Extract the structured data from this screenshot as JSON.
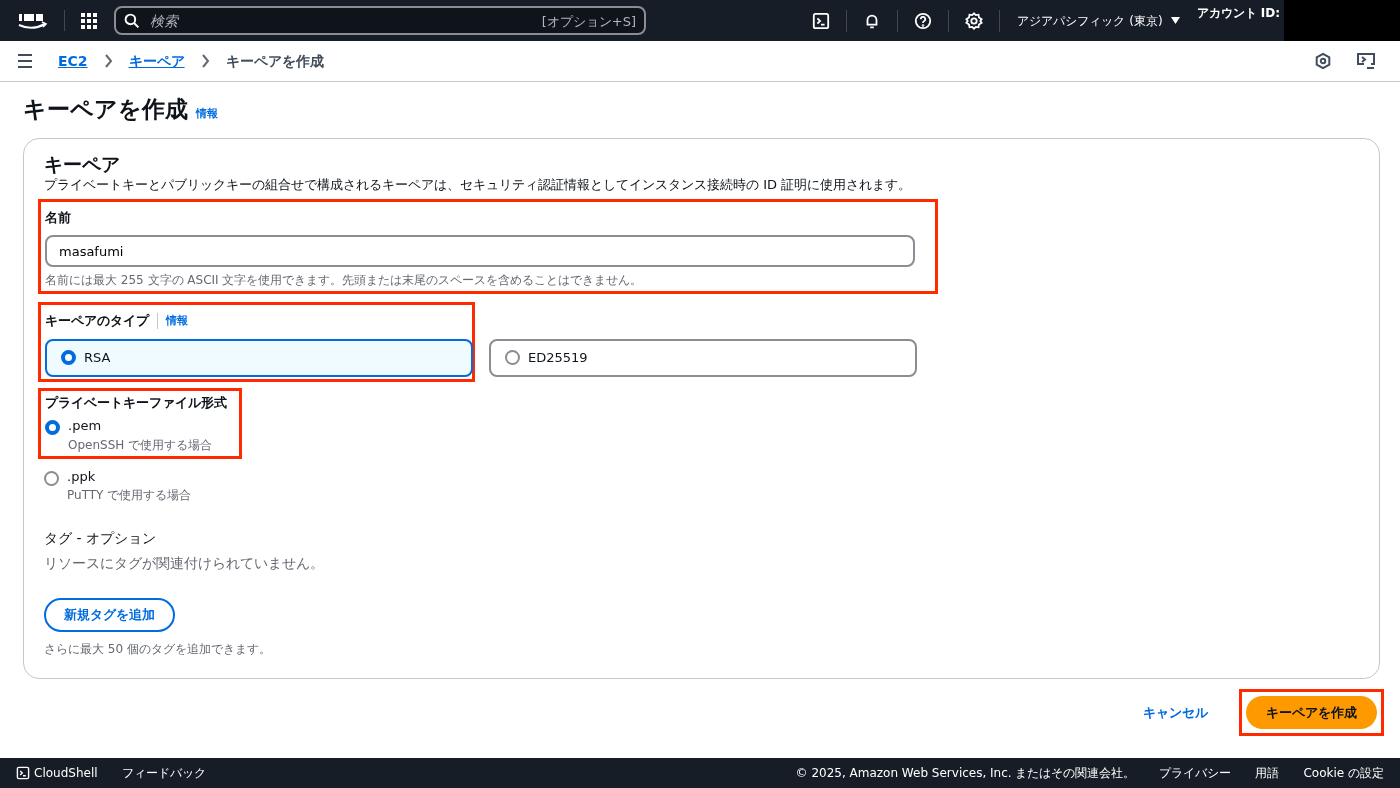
{
  "top_nav": {
    "search_placeholder": "検索",
    "search_shortcut": "[オプション+S]",
    "region": "アジアパシフィック (東京)",
    "account_label": "アカウント ID:",
    "account_redacted": true
  },
  "breadcrumb": [
    {
      "label": "EC2",
      "link": true
    },
    {
      "label": "キーペア",
      "link": true
    },
    {
      "label": "キーペアを作成",
      "link": false
    }
  ],
  "page_title": "キーペアを作成",
  "page_info_link": "情報",
  "card": {
    "title": "キーペア",
    "description": "プライベートキーとパブリックキーの組合せで構成されるキーペアは、セキュリティ認証情報としてインスタンス接続時の ID 証明に使用されます。",
    "name_field": {
      "label": "名前",
      "value": "masafumi",
      "hint": "名前には最大 255 文字の ASCII 文字を使用できます。先頭または末尾のスペースを含めることはできません。",
      "highlighted": true
    },
    "key_type": {
      "label": "キーペアのタイプ",
      "info_link": "情報",
      "highlighted": true,
      "options": [
        {
          "label": "RSA",
          "selected": true
        },
        {
          "label": "ED25519",
          "selected": false
        }
      ]
    },
    "file_format": {
      "label": "プライベートキーファイル形式",
      "highlighted": true,
      "options": [
        {
          "label": ".pem",
          "description": "OpenSSH で使用する場合",
          "selected": true
        },
        {
          "label": ".ppk",
          "description": "PuTTY で使用する場合",
          "selected": false
        }
      ]
    },
    "tags": {
      "title": "タグ - オプション",
      "empty_text": "リソースにタグが関連付けられていません。",
      "add_button": "新規タグを追加",
      "limit_text": "さらに最大 50 個のタグを追加できます。"
    }
  },
  "actions": {
    "cancel": "キャンセル",
    "create": "キーペアを作成",
    "create_highlighted": true
  },
  "footer": {
    "cloudshell": "CloudShell",
    "feedback": "フィードバック",
    "copyright": "© 2025, Amazon Web Services, Inc. またはその関連会社。",
    "links": [
      "プライバシー",
      "用語",
      "Cookie の設定"
    ]
  }
}
